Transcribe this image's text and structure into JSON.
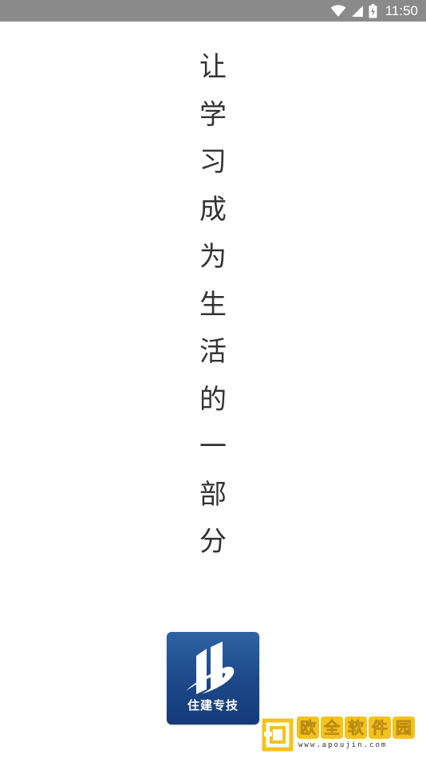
{
  "status_bar": {
    "time": "11:50",
    "icons": [
      "wifi-icon",
      "cell-signal-icon",
      "battery-charging-icon"
    ],
    "background": "#8a8a8a"
  },
  "slogan": {
    "chars": [
      "让",
      "学",
      "习",
      "成",
      "为",
      "生",
      "活",
      "的",
      "一",
      "部",
      "分"
    ],
    "color": "#333333"
  },
  "app_logo": {
    "label": "住建专技",
    "icon": "building-swoosh-icon",
    "color": "#1c4889"
  },
  "watermark": {
    "name_chars": [
      "欧",
      "全",
      "软",
      "件",
      "园"
    ],
    "url": "www.apoujin.com",
    "color": "#f4c21c"
  }
}
